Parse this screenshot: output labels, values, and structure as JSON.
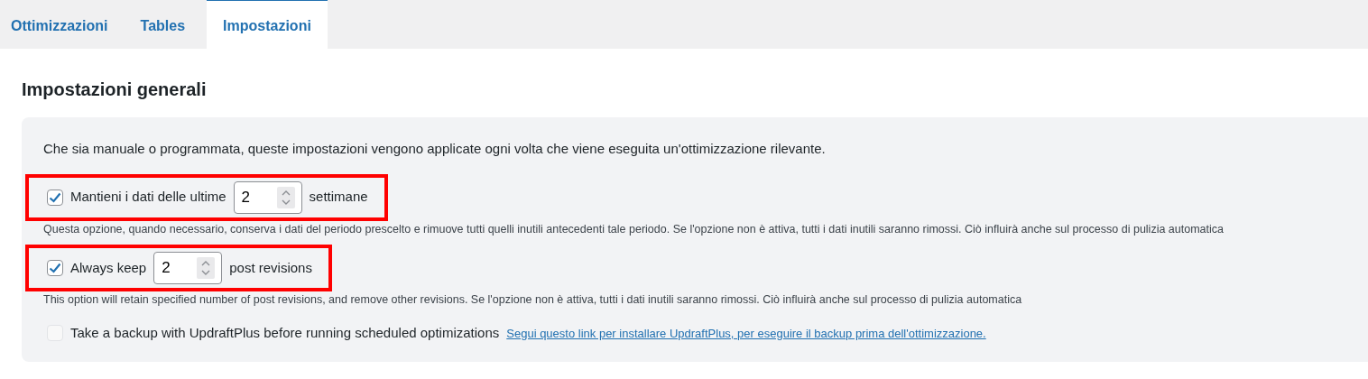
{
  "tabs": [
    {
      "label": "Ottimizzazioni",
      "selected": false
    },
    {
      "label": "Tables",
      "selected": false
    },
    {
      "label": "Impostazioni",
      "selected": true
    }
  ],
  "heading": "Impostazioni generali",
  "intro": "Che sia manuale o programmata, queste impostazioni vengono applicate ogni volta che viene eseguita un'ottimizzazione rilevante.",
  "options": [
    {
      "kind": "number",
      "checked": true,
      "highlighted": true,
      "label_before": "Mantieni i dati delle ultime",
      "value": "2",
      "label_after": "settimane",
      "description": "Questa opzione, quando necessario, conserva i dati del periodo prescelto e rimuove tutti quelli inutili antecedenti tale periodo. Se l'opzione non è attiva, tutti i dati inutili saranno rimossi. Ciò influirà anche sul processo di pulizia automatica"
    },
    {
      "kind": "number",
      "checked": true,
      "highlighted": true,
      "label_before": "Always keep",
      "value": "2",
      "label_after": "post revisions",
      "description": "This option will retain specified number of post revisions, and remove other revisions. Se l'opzione non è attiva, tutti i dati inutili saranno rimossi. Ciò influirà anche sul processo di pulizia automatica"
    },
    {
      "kind": "link",
      "checked": false,
      "disabled": true,
      "highlighted": false,
      "label_before": "Take a backup with UpdraftPlus before running scheduled optimizations",
      "link": "Segui questo link per installare UpdraftPlus, per eseguire il backup prima dell'ottimizzazione."
    }
  ]
}
